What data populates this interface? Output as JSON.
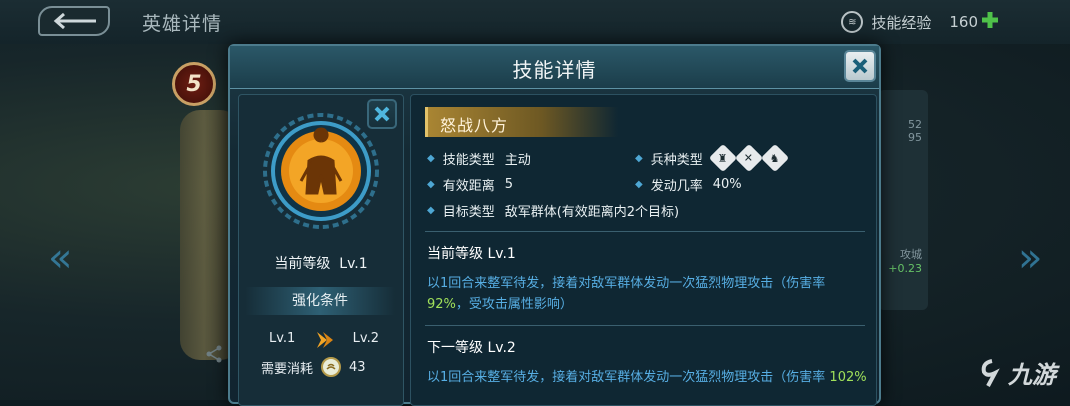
{
  "background": {
    "title": "英雄详情",
    "exp_label": "技能经验",
    "exp_value": "160",
    "hero_level": "5",
    "stats": [
      "52",
      "95",
      "攻城",
      "+0.23"
    ]
  },
  "dialog": {
    "title": "技能详情",
    "skill": {
      "name": "怒战八方",
      "type_label": "技能类型",
      "type_value": "主动",
      "troop_label": "兵种类型",
      "range_label": "有效距离",
      "range_value": "5",
      "rate_label": "发动几率",
      "rate_value": "40%",
      "target_label": "目标类型",
      "target_value": "敌军群体(有效距离内2个目标)"
    },
    "current_level_label": "当前等级",
    "current_level_value": "Lv.1",
    "upgrade": {
      "condition_label": "强化条件",
      "from": "Lv.1",
      "to": "Lv.2",
      "cost_label": "需要消耗",
      "cost_value": "43"
    },
    "current": {
      "heading": "当前等级 Lv.1",
      "desc_a": "以1回合来整军待发，接着对敌军群体发动一次猛烈物理攻击（伤害率",
      "desc_rate": "92%",
      "desc_b": "，受攻击属性影响）"
    },
    "next": {
      "heading": "下一等级 Lv.2",
      "desc_a": "以1回合来整军待发，接着对敌军群体发动一次猛烈物理攻击（伤害率",
      "desc_rate": "102%"
    }
  },
  "watermark": "九游",
  "colors": {
    "accent_blue": "#57aee3",
    "highlight_green": "#a0e05a",
    "gold": "#a98533"
  }
}
